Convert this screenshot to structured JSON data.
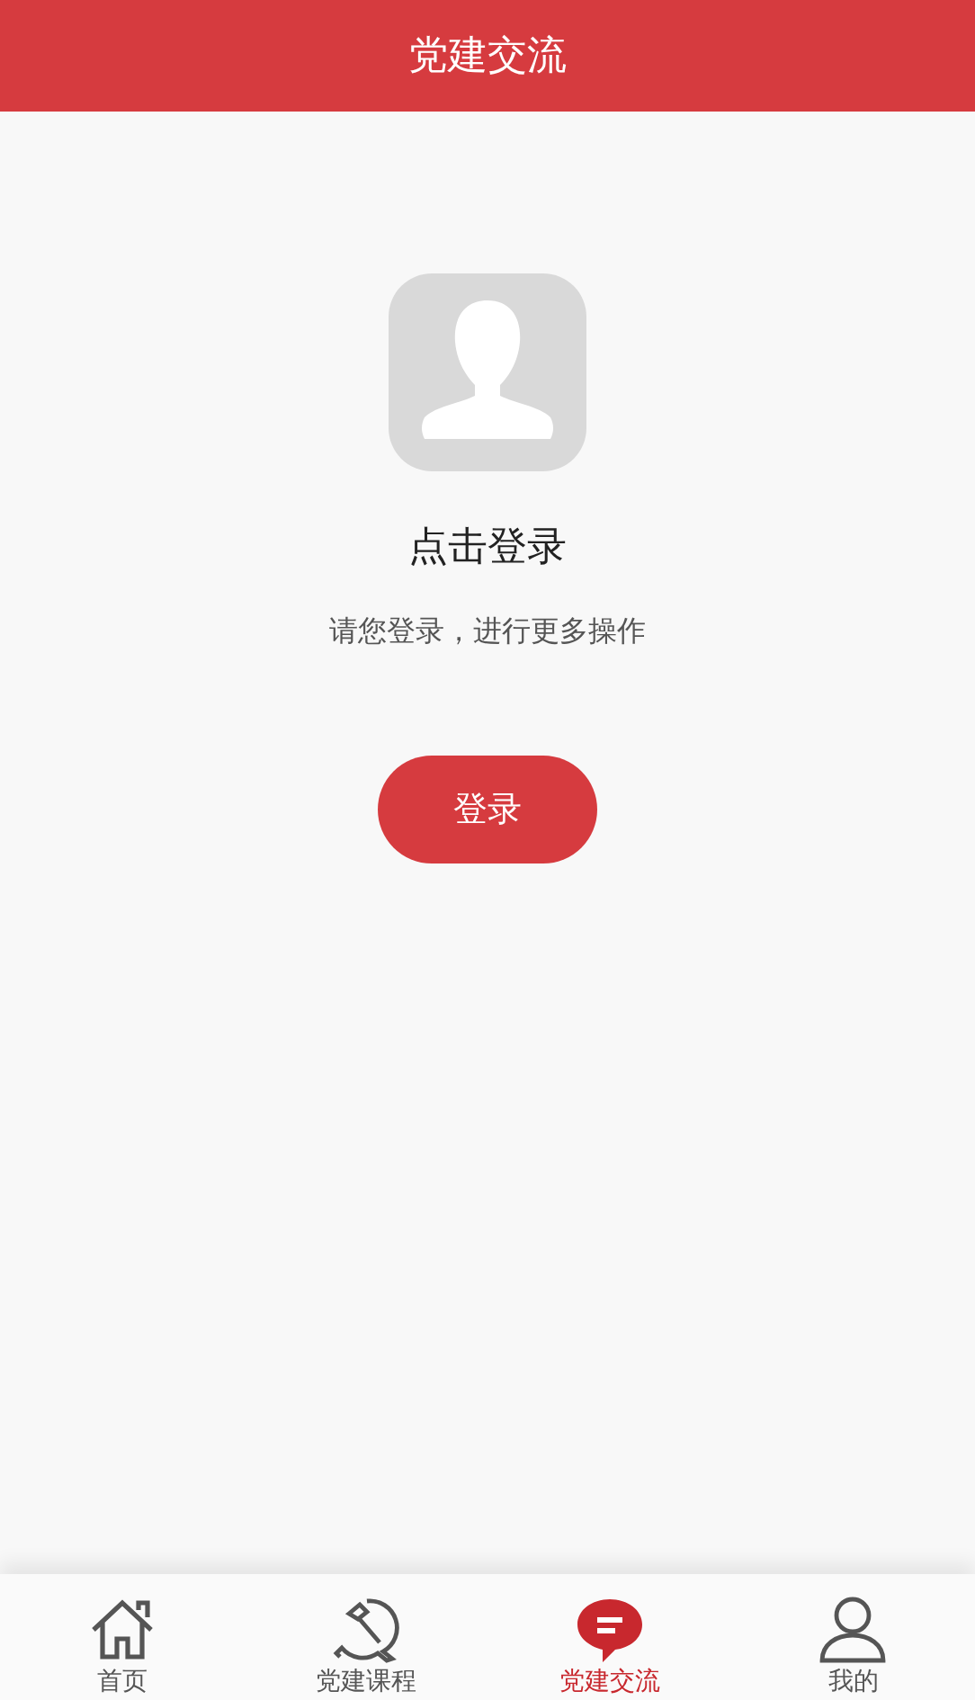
{
  "header": {
    "title": "党建交流"
  },
  "login": {
    "title": "点击登录",
    "subtitle": "请您登录，进行更多操作",
    "button": "登录"
  },
  "tabs": [
    {
      "label": "首页",
      "kind": "home",
      "selected": false
    },
    {
      "label": "党建课程",
      "kind": "emblem",
      "selected": false
    },
    {
      "label": "党建交流",
      "kind": "chat",
      "selected": true
    },
    {
      "label": "我的",
      "kind": "person",
      "selected": false
    }
  ]
}
